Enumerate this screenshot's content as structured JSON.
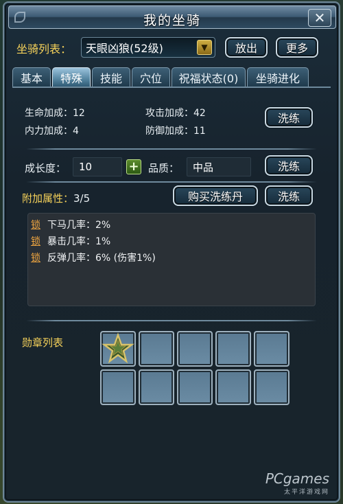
{
  "window": {
    "title": "我的坐骑",
    "close_symbol": "✕"
  },
  "mount_selector": {
    "label": "坐骑列表：",
    "selected": "天眼凶狼(52级)",
    "release_button": "放出",
    "more_button": "更多"
  },
  "tabs": [
    {
      "label": "基本",
      "active": false
    },
    {
      "label": "特殊",
      "active": true
    },
    {
      "label": "技能",
      "active": false
    },
    {
      "label": "穴位",
      "active": false
    },
    {
      "label": "祝福状态(0)",
      "active": false
    },
    {
      "label": "坐骑进化",
      "active": false
    }
  ],
  "bonuses": {
    "hp_label": "生命加成：",
    "hp_value": "12",
    "attack_label": "攻击加成：",
    "attack_value": "42",
    "mp_label": "内力加成：",
    "mp_value": "4",
    "defense_label": "防御加成：",
    "defense_value": "11",
    "refine_button": "洗练"
  },
  "growth": {
    "growth_label": "成长度：",
    "growth_value": "10",
    "quality_label": "品质：",
    "quality_value": "中品",
    "refine_button": "洗练"
  },
  "extra_attributes": {
    "label": "附加属性：",
    "count": "3/5",
    "buy_button": "购买洗练丹",
    "refine_button": "洗练",
    "lock_label": "锁",
    "items": [
      {
        "text": "下马几率：2%"
      },
      {
        "text": "暴击几率：1%"
      },
      {
        "text": "反弹几率：6% (伤害1%)"
      }
    ]
  },
  "medals": {
    "label": "勋章列表",
    "slots": 10,
    "filled": 1
  },
  "watermark": {
    "brand": "PCgames",
    "sub": "太平洋游戏网"
  },
  "colors": {
    "accent_yellow": "#f6d25a",
    "lock_orange": "#f0a640",
    "panel_dark": "#17232d"
  }
}
